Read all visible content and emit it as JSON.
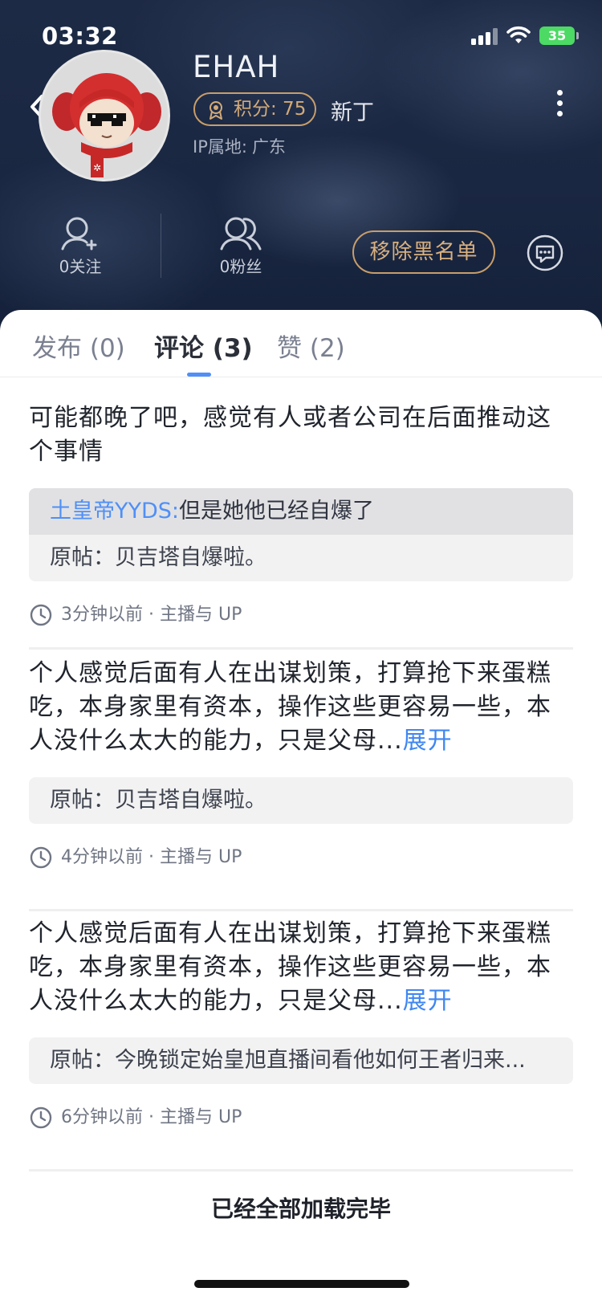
{
  "status_bar": {
    "time": "03:32",
    "battery": "35"
  },
  "profile": {
    "username": "EHAH",
    "points_label": "积分: 75",
    "level": "新丁",
    "ip_label": "IP属地:",
    "ip_value": "广东"
  },
  "stats": {
    "following": "0关注",
    "followers": "0粉丝"
  },
  "actions": {
    "unblock": "移除黑名单"
  },
  "tabs": [
    {
      "label": "发布 (0)",
      "active": false
    },
    {
      "label": "评论 (3)",
      "active": true
    },
    {
      "label": "赞 (2)",
      "active": false
    }
  ],
  "comments": [
    {
      "text": "可能都晚了吧，感觉有人或者公司在后面推动这个事情",
      "expand": "",
      "reply_user": "土皇帝YYDS:",
      "reply_text": "但是她他已经自爆了",
      "original": "原帖：贝吉塔自爆啦。",
      "time": "3分钟以前 · 主播与 UP"
    },
    {
      "text": "个人感觉后面有人在出谋划策，打算抢下来蛋糕吃，本身家里有资本，操作这些更容易一些，本人没什么太大的能力，只是父母...",
      "expand": "展开",
      "original": "原帖：贝吉塔自爆啦。",
      "time": "4分钟以前 · 主播与 UP"
    },
    {
      "text": "个人感觉后面有人在出谋划策，打算抢下来蛋糕吃，本身家里有资本，操作这些更容易一些，本人没什么太大的能力，只是父母...",
      "expand": "展开",
      "original": "原帖：今晚锁定始皇旭直播间看他如何王者归来...",
      "time": "6分钟以前 · 主播与 UP"
    }
  ],
  "footer": {
    "end_text": "已经全部加载完毕"
  },
  "colors": {
    "accent": "#4f8ff7",
    "gold": "#c89e6a",
    "battery": "#4cd964"
  }
}
